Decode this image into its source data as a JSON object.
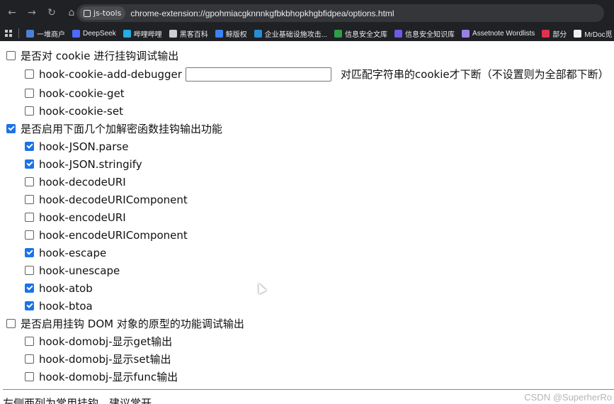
{
  "browser": {
    "extension_chip": "js-tools",
    "url": "chrome-extension://gpohmiacgknnnkgfbkbhopkhgbfidpea/options.html",
    "bookmarks": [
      {
        "label": "一堆商户",
        "color": "#4e7fd8"
      },
      {
        "label": "DeepSeek",
        "color": "#4d6bfe"
      },
      {
        "label": "哔哩哔哩",
        "color": "#23ade5"
      },
      {
        "label": "黑客百科",
        "color": "#cfcfcf"
      },
      {
        "label": "鲸版权",
        "color": "#3b82f6"
      },
      {
        "label": "企业基础设施攻击...",
        "color": "#2a8bd6"
      },
      {
        "label": "信息安全文库",
        "color": "#2e9e44"
      },
      {
        "label": "信息安全知识库",
        "color": "#6d5ae6"
      },
      {
        "label": "Assetnote Wordlists",
        "color": "#9b7fe6"
      },
      {
        "label": "部分",
        "color": "#e0334b"
      },
      {
        "label": "MrDoc觅",
        "color": "#f0f0f0"
      }
    ]
  },
  "options": {
    "cookie_group": {
      "label": "是否对 cookie 进行挂钩调试输出",
      "checked": false,
      "add_debugger": {
        "label": "hook-cookie-add-debugger",
        "checked": false,
        "input_value": "",
        "hint": "对匹配字符串的cookie才下断（不设置则为全部都下断）"
      },
      "get": {
        "label": "hook-cookie-get",
        "checked": false
      },
      "set": {
        "label": "hook-cookie-set",
        "checked": false
      }
    },
    "crypto_group": {
      "label": "是否启用下面几个加解密函数挂钩输出功能",
      "checked": true,
      "items": [
        {
          "label": "hook-JSON.parse",
          "checked": true
        },
        {
          "label": "hook-JSON.stringify",
          "checked": true
        },
        {
          "label": "hook-decodeURI",
          "checked": false
        },
        {
          "label": "hook-decodeURIComponent",
          "checked": false
        },
        {
          "label": "hook-encodeURI",
          "checked": false
        },
        {
          "label": "hook-encodeURIComponent",
          "checked": false
        },
        {
          "label": "hook-escape",
          "checked": true
        },
        {
          "label": "hook-unescape",
          "checked": false
        },
        {
          "label": "hook-atob",
          "checked": true
        },
        {
          "label": "hook-btoa",
          "checked": true
        }
      ]
    },
    "dom_group": {
      "label": "是否启用挂钩 DOM 对象的原型的功能调试输出",
      "checked": false,
      "items": [
        {
          "label": "hook-domobj-显示get输出",
          "checked": false
        },
        {
          "label": "hook-domobj-显示set输出",
          "checked": false
        },
        {
          "label": "hook-domobj-显示func输出",
          "checked": false
        }
      ]
    },
    "bottom_note": "左侧两列为常用挂钩，建议常开"
  },
  "watermark": "CSDN @SuperherRo"
}
